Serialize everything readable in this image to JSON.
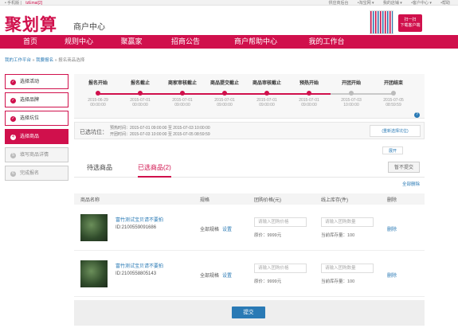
{
  "topbar": {
    "left_text": "• 手机版 |",
    "account": "tzEmai[2]",
    "right_items": [
      "供应商后台",
      "•淘宝网 ▾",
      "我的店铺 ▾",
      "•客户中心 ▾",
      "•帮助"
    ]
  },
  "header": {
    "logo": "聚划算",
    "subtitle": "商户中心",
    "app_button": [
      "扫一扫",
      "下载客户端"
    ]
  },
  "nav": {
    "items": [
      "首页",
      "规则中心",
      "聚赢家",
      "招商公告",
      "商户帮助中心",
      "我的工作台"
    ]
  },
  "breadcrumb": {
    "a": "我的工作平台",
    "sep1": " » ",
    "b": "我要报名",
    "sep2": " » ",
    "c": "报名商品选择"
  },
  "sidebar": {
    "steps": [
      {
        "label": "选择活动",
        "icon": "✓"
      },
      {
        "label": "选择品牌",
        "icon": "✓"
      },
      {
        "label": "选择坑位",
        "icon": "✓"
      },
      {
        "label": "选择商品",
        "icon": "4"
      },
      {
        "label": "填写商品详情",
        "icon": "5"
      },
      {
        "label": "完成报名",
        "icon": "6"
      }
    ]
  },
  "timeline": [
    {
      "title": "报名开始",
      "date": "2015-06-29",
      "time": "00:00:00"
    },
    {
      "title": "报名截止",
      "date": "2015-07-01",
      "time": "00:00:00"
    },
    {
      "title": "商家审核截止",
      "date": "2015-07-01",
      "time": "09:00:00"
    },
    {
      "title": "商品提交截止",
      "date": "2015-07-01",
      "time": "09:00:00"
    },
    {
      "title": "商品审核截止",
      "date": "2015-07-01",
      "time": "09:00:00"
    },
    {
      "title": "预热开始",
      "date": "2015-07-01",
      "time": "09:00:00"
    },
    {
      "title": "开团开始",
      "date": "2015-07-03",
      "time": "10:00:00"
    },
    {
      "title": "开团结束",
      "date": "2015-07-05",
      "time": "08:59:59"
    }
  ],
  "slot": {
    "label": "已选坑位：",
    "preheat": "预热时间：2015-07-01 09:00:00 至 2015-07-03 10:00:00",
    "open": "开团时间：2015-07-03 10:00:00 至 2015-07-05 08:59:59",
    "reselect": "(重新选择坑位)",
    "collapse": "展开"
  },
  "tabs": {
    "pending": "待选商品",
    "selected": "已选商品(2)",
    "nosubmit": "暂不提交",
    "delete_all": "全部删除"
  },
  "table": {
    "headers": [
      "商品名称",
      "规格",
      "团购价格(元)",
      "线上库存(件)",
      "删除"
    ],
    "rows": [
      {
        "name": "富竹测试宝贝请不要拍",
        "id": "ID:2100559091686",
        "spec": "全部规格",
        "spec_set": "设置",
        "price_placeholder": "请输入团购价格",
        "orig_price": "原价：9999元",
        "stock_placeholder": "请输入团购数量",
        "cur_stock": "当前库存量：100",
        "del": "删除"
      },
      {
        "name": "富竹测试宝贝请不要拍",
        "id": "ID:2100558805143",
        "spec": "全部规格",
        "spec_set": "设置",
        "price_placeholder": "请输入团购价格",
        "orig_price": "原价：9999元",
        "stock_placeholder": "请输入团购数量",
        "cur_stock": "当前库存量：100",
        "del": "删除"
      }
    ]
  },
  "submit_label": "提交",
  "colors": {
    "brand": "#d0104c",
    "link": "#2a7ab5"
  }
}
